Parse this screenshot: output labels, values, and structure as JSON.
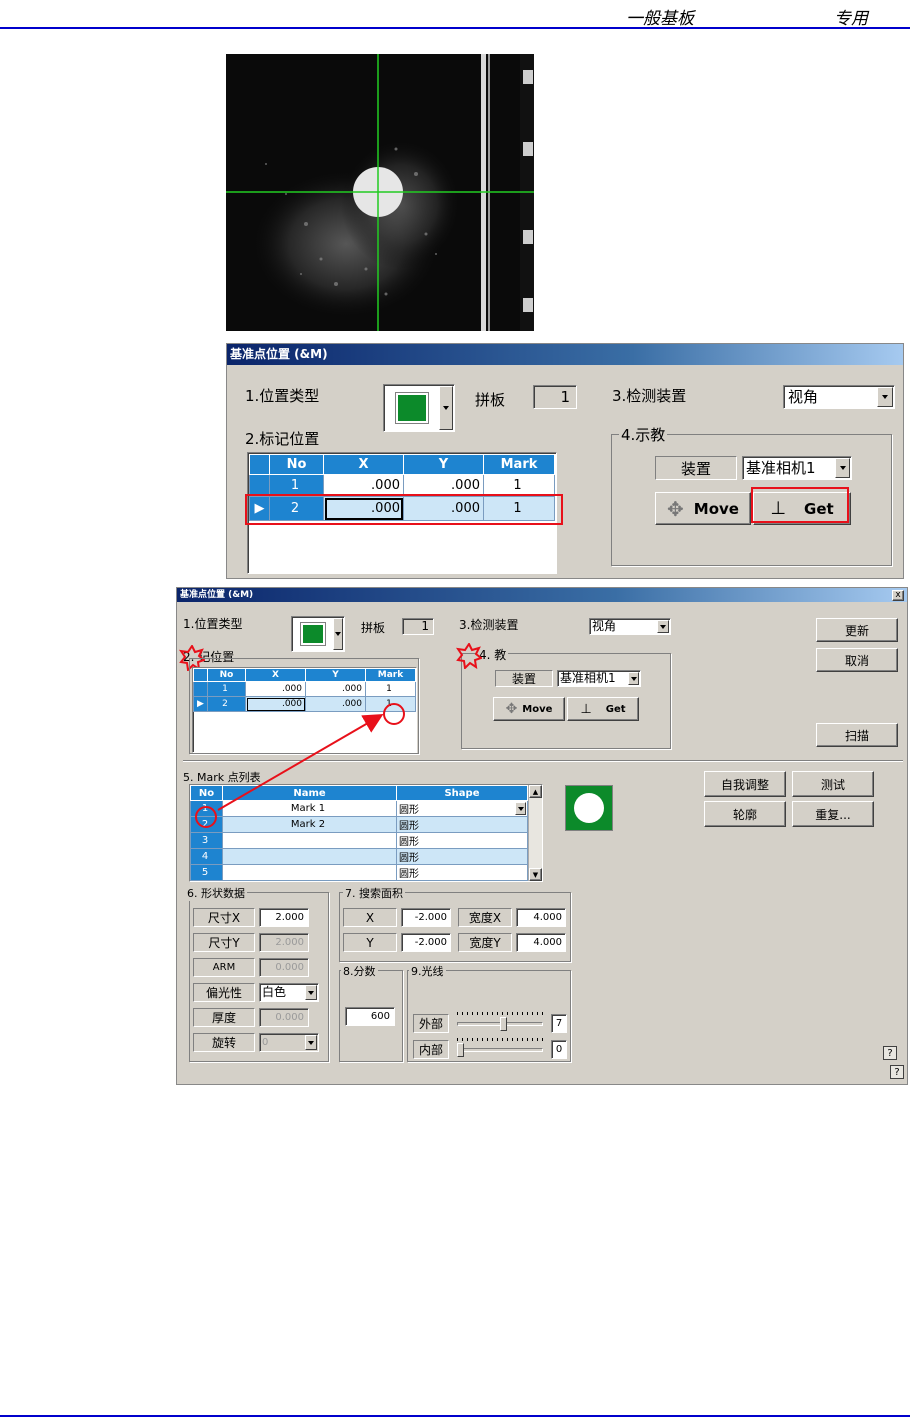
{
  "header": {
    "left": "一般基板",
    "right": "专用"
  },
  "dialog_large": {
    "title": "基准点位置 (&M)",
    "position_type_label": "1.位置类型",
    "panel_label": "拼板",
    "panel_value": "1",
    "detect_device_label": "3.检测装置",
    "detect_device_value": "视角",
    "mark_position_label": "2.标记位置",
    "table_headers": [
      "No",
      "X",
      "Y",
      "Mark"
    ],
    "rows": [
      {
        "no": "1",
        "x": ".000",
        "y": ".000",
        "mark": "1"
      },
      {
        "no": "2",
        "x": ".000",
        "y": ".000",
        "mark": "1"
      }
    ],
    "teach_label": "4.示教",
    "device_label": "装置",
    "device_value": "基准相机1",
    "move_label": "Move",
    "get_label": "Get"
  },
  "dialog_small": {
    "title": "基准点位置 (&M)",
    "close": "x",
    "position_type_label": "1.位置类型",
    "panel_label": "拼板",
    "panel_value": "1",
    "detect_device_label": "3.检测装置",
    "detect_device_value": "视角",
    "mark_position_label": "2.标记位置",
    "mark_position_visible": "2. 记位置",
    "table_headers": [
      "No",
      "X",
      "Y",
      "Mark"
    ],
    "rows": [
      {
        "no": "1",
        "x": ".000",
        "y": ".000",
        "mark": "1"
      },
      {
        "no": "2",
        "x": ".000",
        "y": ".000",
        "mark": "1"
      }
    ],
    "teach_label": "4.示教",
    "teach_visible": "4. 教",
    "device_label": "装置",
    "device_value": "基准相机1",
    "move_label": "Move",
    "get_label": "Get",
    "update_label": "更新",
    "cancel_label": "取消",
    "scan_label": "扫描",
    "self_adjust_label": "自我调整",
    "test_label": "测试",
    "contour_label": "轮廓",
    "repeat_label": "重复...",
    "mark_list_label": "5. Mark 点列表",
    "mark_headers": [
      "No",
      "Name",
      "Shape"
    ],
    "mark_rows": [
      {
        "no": "1",
        "name": "Mark 1",
        "shape": "圆形"
      },
      {
        "no": "2",
        "name": "Mark 2",
        "shape": "圆形"
      },
      {
        "no": "3",
        "name": "",
        "shape": "圆形"
      },
      {
        "no": "4",
        "name": "",
        "shape": "圆形"
      },
      {
        "no": "5",
        "name": "",
        "shape": "圆形"
      }
    ],
    "shape_data_label": "6. 形状数据",
    "size_x_label": "尺寸X",
    "size_x_value": "2.000",
    "size_y_label": "尺寸Y",
    "size_y_value": "2.000",
    "arm_label": "ARM",
    "arm_value": "0.000",
    "polarity_label": "偏光性",
    "polarity_value": "白色",
    "thickness_label": "厚度",
    "thickness_value": "0.000",
    "rotation_label": "旋转",
    "rotation_value": "0",
    "search_area_label": "7. 搜索面积",
    "x_label": "X",
    "x_value": "-2.000",
    "width_x_label": "宽度X",
    "width_x_value": "4.000",
    "y_label": "Y",
    "y_value": "-2.000",
    "width_y_label": "宽度Y",
    "width_y_value": "4.000",
    "score_label": "8.分数",
    "score_value": "600",
    "light_label": "9.光线",
    "outer_label": "外部",
    "outer_value": "7",
    "outer_level": 0.55,
    "inner_label": "内部",
    "inner_value": "0",
    "inner_level": 0.0,
    "help": "?"
  },
  "colors": {
    "header_blue": "#1e84d0",
    "mark_green": "#0c8a2a",
    "annotation_red": "#e8101a",
    "rule_blue": "#0000cc"
  }
}
